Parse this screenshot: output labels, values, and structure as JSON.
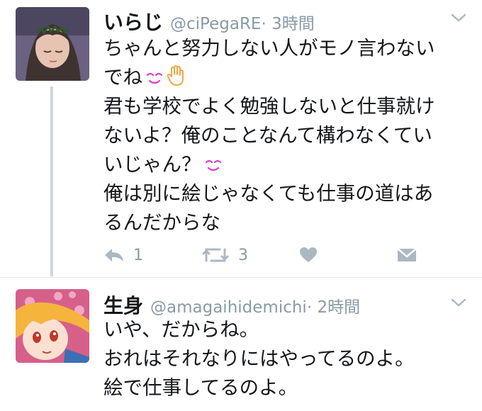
{
  "tweets": [
    {
      "name": "いらじ",
      "handle": "@ciPegaRE",
      "time": "· 3時間",
      "lines": [
        "ちゃんと努力しない人がモノ言わない",
        "でね",
        "君も学校でよく勉強しないと仕事就け",
        "ないよ？俺のことなんて構わなくてい",
        "いじゃん？",
        "俺は別に絵じゃなくても仕事の道はあ",
        "るんだからな"
      ],
      "emojis": [
        "smile-eyes-emoji",
        "raised-hand-emoji",
        "smile-eyes-emoji"
      ],
      "reply_count": "1",
      "retweet_count": "3"
    },
    {
      "name": "生身",
      "handle": "@amagaihidemichi",
      "time": "· 2時間",
      "lines": [
        "いや、だからね。",
        "おれはそれなりにはやってるのよ。",
        "絵で仕事してるのよ。"
      ]
    }
  ],
  "colors": {
    "meta_gray": "#8a9aa6",
    "icon_gray": "#aab8c2",
    "thread_line": "#ccd6dd",
    "emoji_pink": "#e040c8",
    "emoji_orange": "#f4a640"
  },
  "icons": [
    "reply-icon",
    "retweet-icon",
    "like-icon",
    "direct-message-icon",
    "chevron-down-icon"
  ]
}
